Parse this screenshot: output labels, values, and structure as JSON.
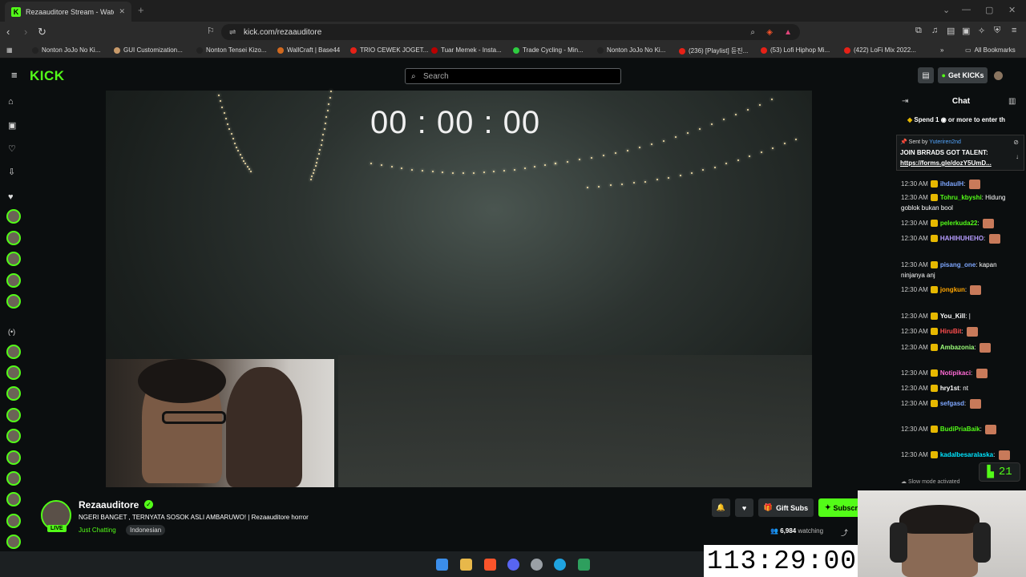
{
  "browser": {
    "tab_title": "Rezaauditore Stream - Watch",
    "url": "kick.com/rezaauditore",
    "all_bookmarks": "All Bookmarks",
    "bookmarks": [
      {
        "label": "Nonton JoJo No Ki...",
        "color": "#222"
      },
      {
        "label": "GUI Customization...",
        "color": "#c89a6a"
      },
      {
        "label": "Nonton Tensei Kizo...",
        "color": "#222"
      },
      {
        "label": "WallCraft | Base44",
        "color": "#d2691e"
      },
      {
        "label": "TRIO CEWEK JOGET...",
        "color": "#e62117"
      },
      {
        "label": "Tuar Memek - Insta...",
        "color": "#b00"
      },
      {
        "label": "Trade Cycling - Min...",
        "color": "#2ecc40"
      },
      {
        "label": "Nonton JoJo No Ki...",
        "color": "#222"
      },
      {
        "label": "(236) [Playlist] 듣진...",
        "color": "#e62117"
      },
      {
        "label": "(53) Lofi Hiphop Mi...",
        "color": "#e62117"
      },
      {
        "label": "(422) LoFi Mix 2022...",
        "color": "#e62117"
      }
    ]
  },
  "header": {
    "logo": "KICK",
    "search_placeholder": "Search",
    "get_kicks": "Get KICKs"
  },
  "video": {
    "overlay_timer": "00 : 00 : 00"
  },
  "stream": {
    "channel": "Rezaauditore",
    "live_badge": "LIVE",
    "title": "NGERI BANGET , TERNYATA SOSOK ASLI AMBARUWO! | Rezaauditore horror",
    "category": "Just Chatting",
    "tag": "Indonesian",
    "gift_subs": "Gift Subs",
    "subscribe": "Subscribe",
    "viewers": "6,984",
    "watching_label": "watching"
  },
  "chat": {
    "heading": "Chat",
    "spend_banner": "Spend 1 ◉ or more to enter th",
    "pinned_sent_by": "Sent by",
    "pinned_user": "Yuteriren2nd",
    "pinned_line1": "JOIN BRRADS GOT TALENT:",
    "pinned_line2": "https://forms.gle/dozY5UmD...",
    "messages": [
      {
        "time": "12:30 AM",
        "user": "ihdaulH",
        "color": "#7ea7ff",
        "text": ""
      },
      {
        "time": "12:30 AM",
        "user": "Tohru_kbyshi",
        "color": "#53fc18",
        "text": "Hidung goblok bukan bool"
      },
      {
        "time": "12:30 AM",
        "user": "pelerkuda22",
        "color": "#53fc18",
        "text": ""
      },
      {
        "time": "12:30 AM",
        "user": "HAHIHUHEHO",
        "color": "#b69cff",
        "text": ""
      },
      {
        "time": "12:30 AM",
        "user": "pisang_one",
        "color": "#7ea7ff",
        "text": "kapan ninjanya anj"
      },
      {
        "time": "12:30 AM",
        "user": "jongkun",
        "color": "#ffa500",
        "text": ""
      },
      {
        "time": "12:30 AM",
        "user": "You_Kill",
        "color": "#ffffff",
        "text": "|"
      },
      {
        "time": "12:30 AM",
        "user": "HiruBit",
        "color": "#ff4d4d",
        "text": ""
      },
      {
        "time": "12:30 AM",
        "user": "Ambazonia",
        "color": "#9dff7a",
        "text": ""
      },
      {
        "time": "12:30 AM",
        "user": "Notipikaci",
        "color": "#ff6ad5",
        "text": ""
      },
      {
        "time": "12:30 AM",
        "user": "hry1st",
        "color": "#ffffff",
        "text": "nt"
      },
      {
        "time": "12:30 AM",
        "user": "sefgasd",
        "color": "#7ea7ff",
        "text": ""
      },
      {
        "time": "12:30 AM",
        "user": "BudiPriaBaik",
        "color": "#53fc18",
        "text": ""
      },
      {
        "time": "12:30 AM",
        "user": "kadalbesaralaska",
        "color": "#00e5ff",
        "text": ""
      }
    ],
    "slow_mode": "Slow mode activated",
    "kick_counter": "21"
  },
  "overlays": {
    "big_timer": "113:29:00"
  }
}
